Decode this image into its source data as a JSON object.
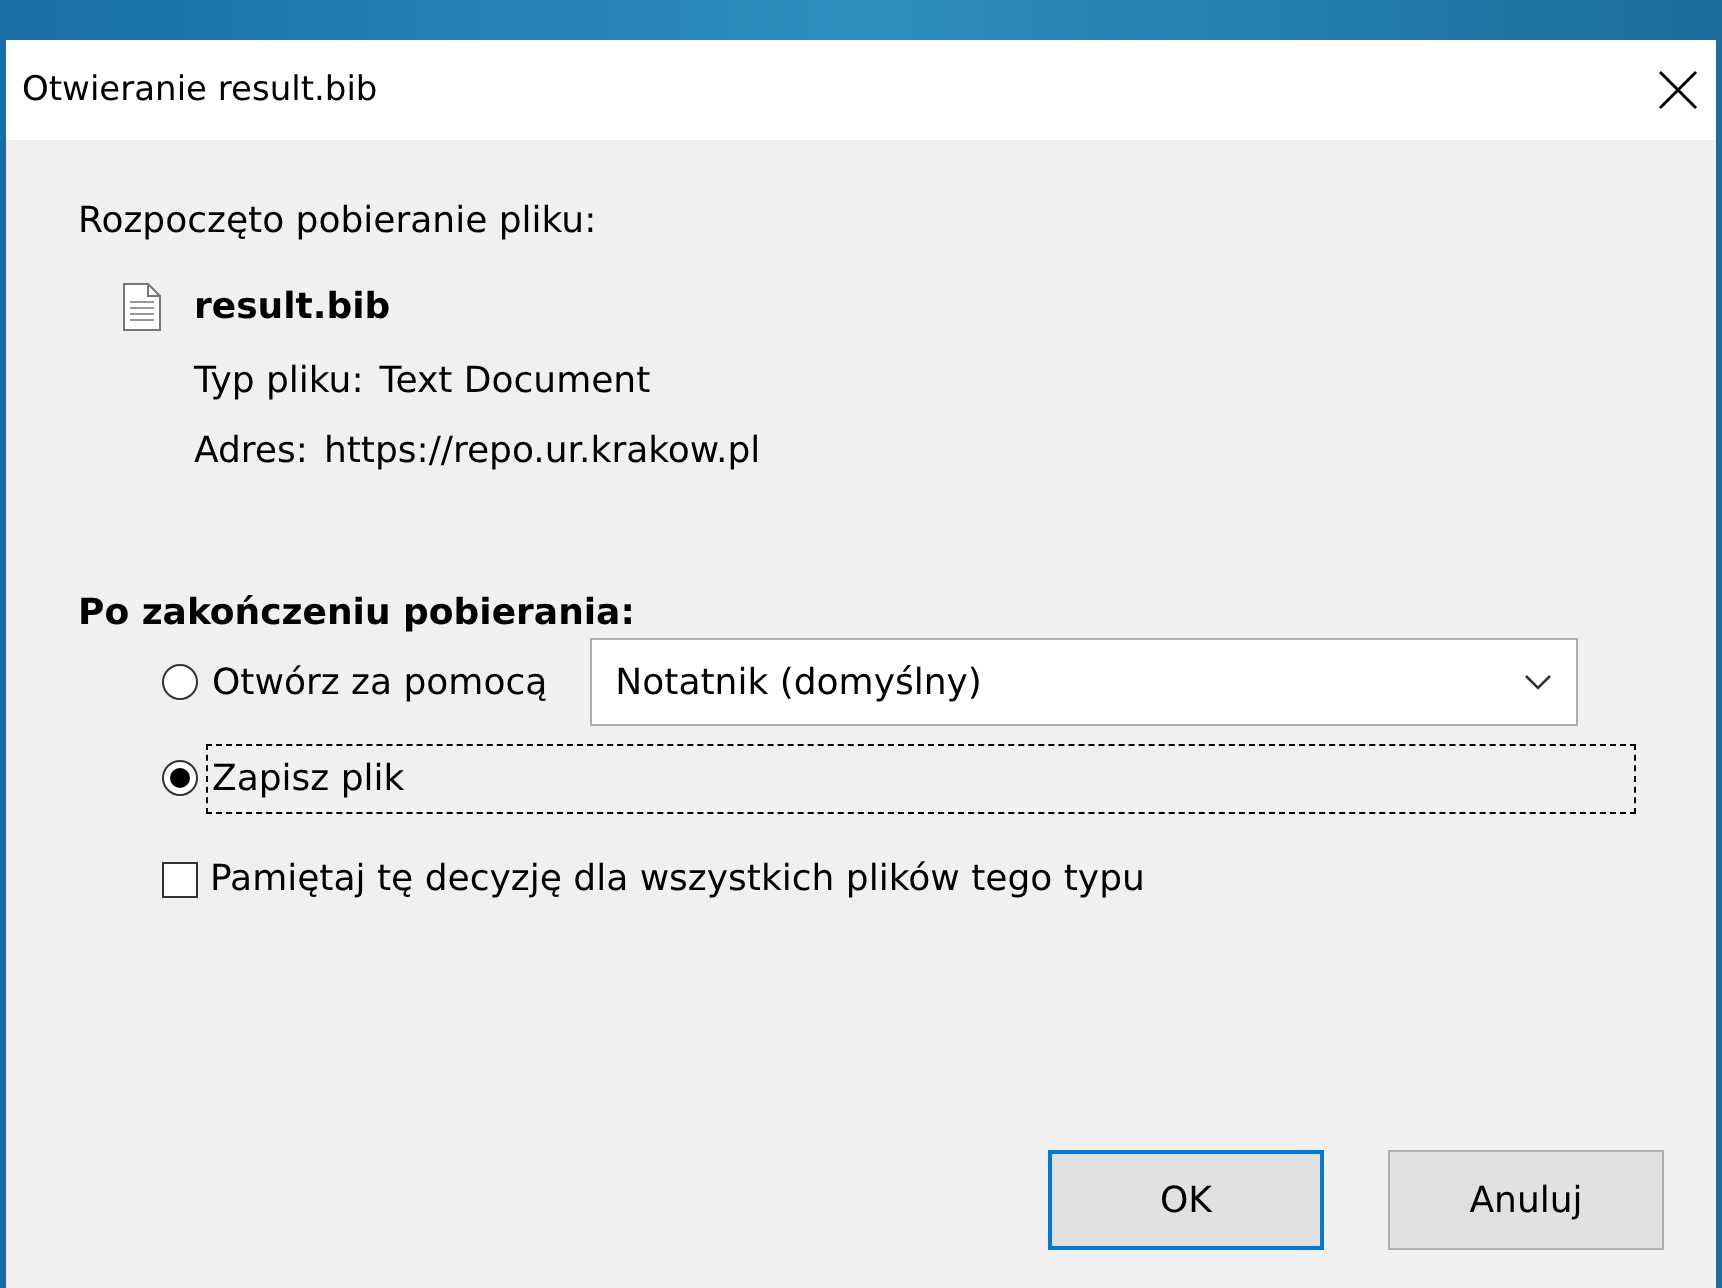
{
  "window": {
    "title": "Otwieranie result.bib"
  },
  "intro": "Rozpoczęto pobieranie pliku:",
  "file": {
    "name": "result.bib",
    "details": [
      {
        "label": "Typ pliku:",
        "value": "Text Document"
      },
      {
        "label": "Adres:",
        "value": "https://repo.ur.krakow.pl"
      }
    ]
  },
  "section_title": "Po zakończeniu pobierania:",
  "options": [
    {
      "kind": "open_with",
      "label": "Otwórz za pomocą",
      "selected": false,
      "focused": false,
      "dropdown": {
        "value": "Notatnik (domyślny)"
      }
    },
    {
      "kind": "save",
      "label": "Zapisz plik",
      "selected": true,
      "focused": true
    }
  ],
  "remember": {
    "label": "Pamiętaj tę decyzję dla wszystkich plików tego typu",
    "checked": false
  },
  "buttons": [
    {
      "label": "OK",
      "default": true
    },
    {
      "label": "Anuluj",
      "default": false
    }
  ]
}
